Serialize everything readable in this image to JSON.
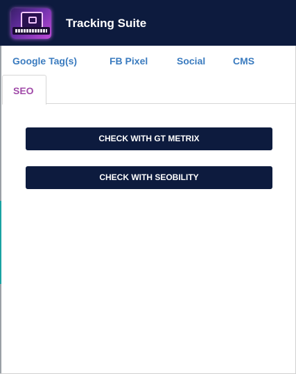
{
  "header": {
    "title": "Tracking Suite",
    "logo_icon": "tracking-suite-logo-icon",
    "background": "#0d1b3e"
  },
  "tabs": [
    {
      "id": "google",
      "label": "Google Tag(s)",
      "active": false
    },
    {
      "id": "fb",
      "label": "FB Pixel",
      "active": false
    },
    {
      "id": "social",
      "label": "Social",
      "active": false
    },
    {
      "id": "cms",
      "label": "CMS",
      "active": false
    },
    {
      "id": "seo",
      "label": "SEO",
      "active": true
    }
  ],
  "colors": {
    "tab_inactive": "#3a7bbf",
    "tab_active": "#a04aa8",
    "button_bg": "#0d1b3e",
    "button_text": "#ffffff"
  },
  "seo_panel": {
    "buttons": [
      {
        "id": "gtmetrix",
        "label": "CHECK WITH GT METRIX"
      },
      {
        "id": "seobility",
        "label": "CHECK WITH SEOBILITY"
      }
    ]
  }
}
